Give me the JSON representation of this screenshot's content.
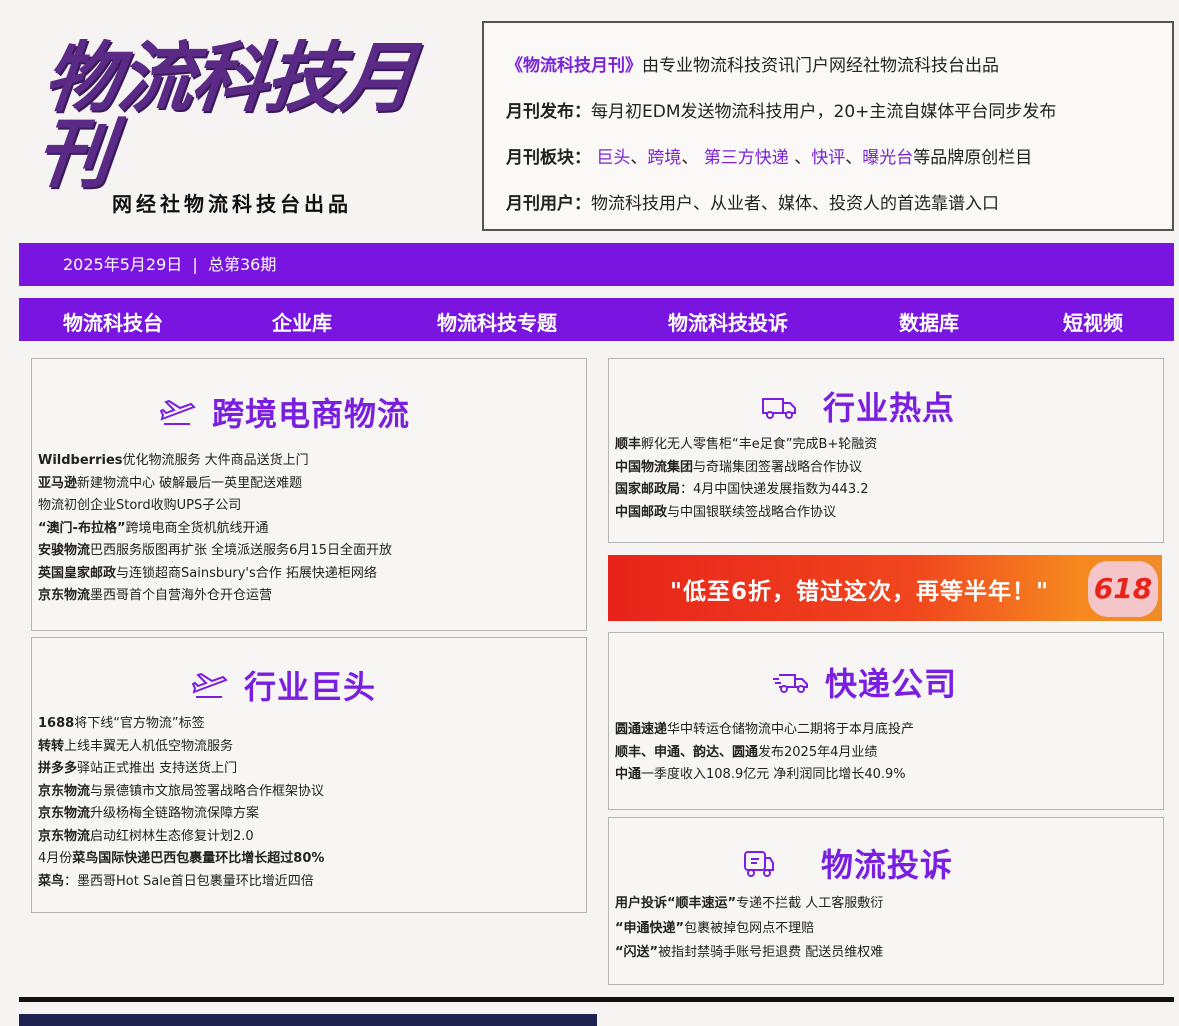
{
  "masthead": {
    "title": "物流科技月刊",
    "subtitle": "网经社物流科技台出品"
  },
  "intro": {
    "line1_name": "《物流科技月刊》",
    "line1_rest": "由专业物流科技资讯门户网经社物流科技台出品",
    "line2_label": "月刊发布：",
    "line2_text": "每月初EDM发送物流科技用户，20+主流自媒体平台同步发布",
    "line3_label": "月刊板块：",
    "line3_items": [
      "巨头",
      "跨境",
      "第三方快递",
      "快评",
      "曝光台"
    ],
    "line3_suffix": "等品牌原创栏目",
    "line4_label": "月刊用户：",
    "line4_text": "物流科技用户、从业者、媒体、投资人的首选靠谱入口"
  },
  "datebar": {
    "text": "2025年5月29日  |  总第36期"
  },
  "nav": [
    "物流科技台",
    "企业库",
    "物流科技专题",
    "物流科技投诉",
    "数据库",
    "短视频"
  ],
  "panels": {
    "crossborder": {
      "title": "跨境电商物流",
      "icon": "airplane-icon",
      "items": [
        [
          "Wildberries",
          "优化物流服务 大件商品送货上门"
        ],
        [
          "亚马逊",
          "新建物流中心 破解最后一英里配送难题"
        ],
        [
          "",
          "物流初创企业Stord收购UPS子公司"
        ],
        [
          "“澳门-布拉格”",
          "跨境电商全货机航线开通"
        ],
        [
          "安骏物流",
          "巴西服务版图再扩张 全境派送服务6月15日全面开放"
        ],
        [
          "英国皇家邮政",
          "与连锁超商Sainsbury's合作 拓展快递柜网络"
        ],
        [
          "京东物流",
          "墨西哥首个自营海外仓开仓运营"
        ]
      ]
    },
    "giants": {
      "title": "行业巨头",
      "icon": "airplane-icon",
      "items": [
        [
          "1688",
          "将下线“官方物流”标签"
        ],
        [
          "转转",
          "上线丰翼无人机低空物流服务"
        ],
        [
          "拼多多",
          "驿站正式推出 支持送货上门"
        ],
        [
          "京东物流",
          "与景德镇市文旅局签署战略合作框架协议"
        ],
        [
          "京东物流",
          "升级杨梅全链路物流保障方案"
        ],
        [
          "京东物流",
          "启动红树林生态修复计划2.0"
        ],
        [
          "4月份",
          "菜鸟国际快递巴西包裹量环比增长超过80%"
        ],
        [
          "菜鸟",
          "：墨西哥Hot Sale首日包裹量环比增近四倍"
        ]
      ]
    },
    "hot": {
      "title": "行业热点",
      "icon": "truck-icon",
      "items": [
        [
          "顺丰",
          "孵化无人零售柜“丰e足食”完成B+轮融资"
        ],
        [
          "中国物流集团",
          "与奇瑞集团签署战略合作协议"
        ],
        [
          "国家邮政局",
          "：4月中国快递发展指数为443.2"
        ],
        [
          "中国邮政",
          "与中国银联续签战略合作协议"
        ]
      ]
    },
    "express": {
      "title": "快递公司",
      "icon": "delivery-truck-icon",
      "items": [
        [
          "圆通速递",
          "华中转运仓储物流中心二期将于本月底投产"
        ],
        [
          "顺丰、申通、韵达、圆通",
          "发布2025年4月业绩"
        ],
        [
          "中通",
          "一季度收入108.9亿元 净利润同比增长40.9%"
        ]
      ]
    },
    "complaint": {
      "title": "物流投诉",
      "icon": "complaint-truck-icon",
      "items": [
        [
          "用户投诉“顺丰速运”",
          "专递不拦截 人工客服敷衍"
        ],
        [
          "“申通快递”",
          "包裹被掉包网点不理赔"
        ],
        [
          "“闪送”",
          "被指封禁骑手账号拒退费 配送员维权难"
        ]
      ]
    }
  },
  "banner": {
    "message": "\"低至6折，错过这次，再等半年！\"",
    "badge": "618"
  },
  "colors": {
    "accent": "#7a14e0",
    "masthead": "#5b2a86",
    "banner_start": "#e8231a"
  }
}
